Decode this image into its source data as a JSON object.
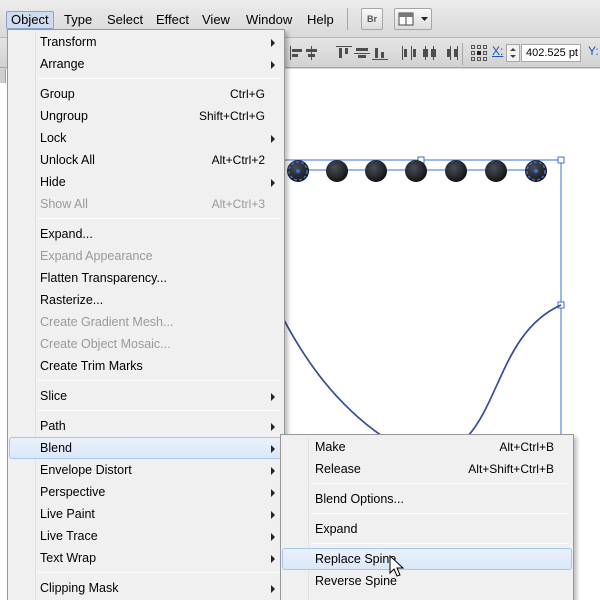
{
  "menubar": {
    "items": [
      "Object",
      "Type",
      "Select",
      "Effect",
      "View",
      "Window",
      "Help"
    ],
    "active": "Object",
    "bridge_button": "Br",
    "workspace_icon": "workspace-arrange-icon"
  },
  "controlbar": {
    "x_label": "X:",
    "x_value": "402.525 pt",
    "y_label": "Y:"
  },
  "object_menu": {
    "items": [
      {
        "label": "Transform",
        "shortcut": "",
        "submenu": true,
        "enabled": true
      },
      {
        "label": "Arrange",
        "shortcut": "",
        "submenu": true,
        "enabled": true
      },
      {
        "label": "Group",
        "shortcut": "Ctrl+G",
        "submenu": false,
        "enabled": true
      },
      {
        "label": "Ungroup",
        "shortcut": "Shift+Ctrl+G",
        "submenu": false,
        "enabled": true
      },
      {
        "label": "Lock",
        "shortcut": "",
        "submenu": true,
        "enabled": true
      },
      {
        "label": "Unlock All",
        "shortcut": "Alt+Ctrl+2",
        "submenu": false,
        "enabled": true
      },
      {
        "label": "Hide",
        "shortcut": "",
        "submenu": true,
        "enabled": true
      },
      {
        "label": "Show All",
        "shortcut": "Alt+Ctrl+3",
        "submenu": false,
        "enabled": false
      },
      {
        "label": "Expand...",
        "shortcut": "",
        "submenu": false,
        "enabled": true
      },
      {
        "label": "Expand Appearance",
        "shortcut": "",
        "submenu": false,
        "enabled": false
      },
      {
        "label": "Flatten Transparency...",
        "shortcut": "",
        "submenu": false,
        "enabled": true
      },
      {
        "label": "Rasterize...",
        "shortcut": "",
        "submenu": false,
        "enabled": true
      },
      {
        "label": "Create Gradient Mesh...",
        "shortcut": "",
        "submenu": false,
        "enabled": false
      },
      {
        "label": "Create Object Mosaic...",
        "shortcut": "",
        "submenu": false,
        "enabled": false
      },
      {
        "label": "Create Trim Marks",
        "shortcut": "",
        "submenu": false,
        "enabled": true
      },
      {
        "label": "Slice",
        "shortcut": "",
        "submenu": true,
        "enabled": true
      },
      {
        "label": "Path",
        "shortcut": "",
        "submenu": true,
        "enabled": true
      },
      {
        "label": "Blend",
        "shortcut": "",
        "submenu": true,
        "enabled": true,
        "highlighted": true
      },
      {
        "label": "Envelope Distort",
        "shortcut": "",
        "submenu": true,
        "enabled": true
      },
      {
        "label": "Perspective",
        "shortcut": "",
        "submenu": true,
        "enabled": true
      },
      {
        "label": "Live Paint",
        "shortcut": "",
        "submenu": true,
        "enabled": true
      },
      {
        "label": "Live Trace",
        "shortcut": "",
        "submenu": true,
        "enabled": true
      },
      {
        "label": "Text Wrap",
        "shortcut": "",
        "submenu": true,
        "enabled": true
      },
      {
        "label": "Clipping Mask",
        "shortcut": "",
        "submenu": true,
        "enabled": true
      }
    ]
  },
  "blend_menu": {
    "items": [
      {
        "label": "Make",
        "shortcut": "Alt+Ctrl+B",
        "enabled": true
      },
      {
        "label": "Release",
        "shortcut": "Alt+Shift+Ctrl+B",
        "enabled": true
      },
      {
        "label": "Blend Options...",
        "shortcut": "",
        "enabled": true
      },
      {
        "label": "Expand",
        "shortcut": "",
        "enabled": true
      },
      {
        "label": "Replace Spine",
        "shortcut": "",
        "enabled": true,
        "highlighted": true
      },
      {
        "label": "Reverse Spine",
        "shortcut": "",
        "enabled": true
      }
    ]
  },
  "colors": {
    "selection": "#3a6fd8",
    "menu_highlight": "#dbe8f9",
    "disabled_text": "#9a9a9a"
  }
}
